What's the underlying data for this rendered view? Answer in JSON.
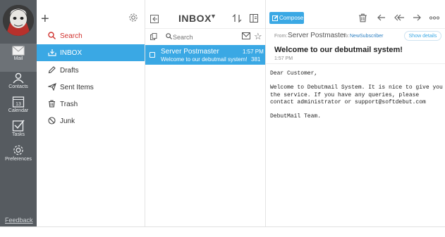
{
  "rail": {
    "items": [
      {
        "label": "Mail",
        "icon": "mail-icon"
      },
      {
        "label": "Contacts",
        "icon": "contacts-icon"
      },
      {
        "label": "Calendar",
        "icon": "calendar-icon",
        "day": "13"
      },
      {
        "label": "Tasks",
        "icon": "tasks-icon"
      },
      {
        "label": "Preferences",
        "icon": "gear-icon"
      }
    ],
    "feedback": "Feedback"
  },
  "folders": {
    "items": [
      {
        "label": "Search",
        "icon": "search-icon"
      },
      {
        "label": "INBOX",
        "icon": "inbox-icon"
      },
      {
        "label": "Drafts",
        "icon": "pencil-icon"
      },
      {
        "label": "Sent Items",
        "icon": "send-icon"
      },
      {
        "label": "Trash",
        "icon": "trash-icon"
      },
      {
        "label": "Junk",
        "icon": "block-icon"
      }
    ]
  },
  "list": {
    "title": "INBOX",
    "search_placeholder": "Search",
    "messages": [
      {
        "from": "Server Postmaster",
        "time": "1:57 PM",
        "subject": "Welcome to our debutmail system!",
        "size": "381"
      }
    ]
  },
  "reader": {
    "compose_label": "Compose",
    "from_label": "From:",
    "from": "Server Postmaster",
    "to_label": "To:",
    "to": "NewSubscriber",
    "show_details": "Show details",
    "subject": "Welcome to our debutmail system!",
    "time": "1:57 PM",
    "body": [
      "Dear Customer,",
      "Welcome to Debutmail System. It is nice to give you\nthe service. If you have any queries, please\ncontact administrator or support@softdebut.com",
      "DebutMail Team."
    ]
  },
  "colors": {
    "accent": "#3aa8e4",
    "rail": "#565b60",
    "search_red": "#d0312d"
  }
}
